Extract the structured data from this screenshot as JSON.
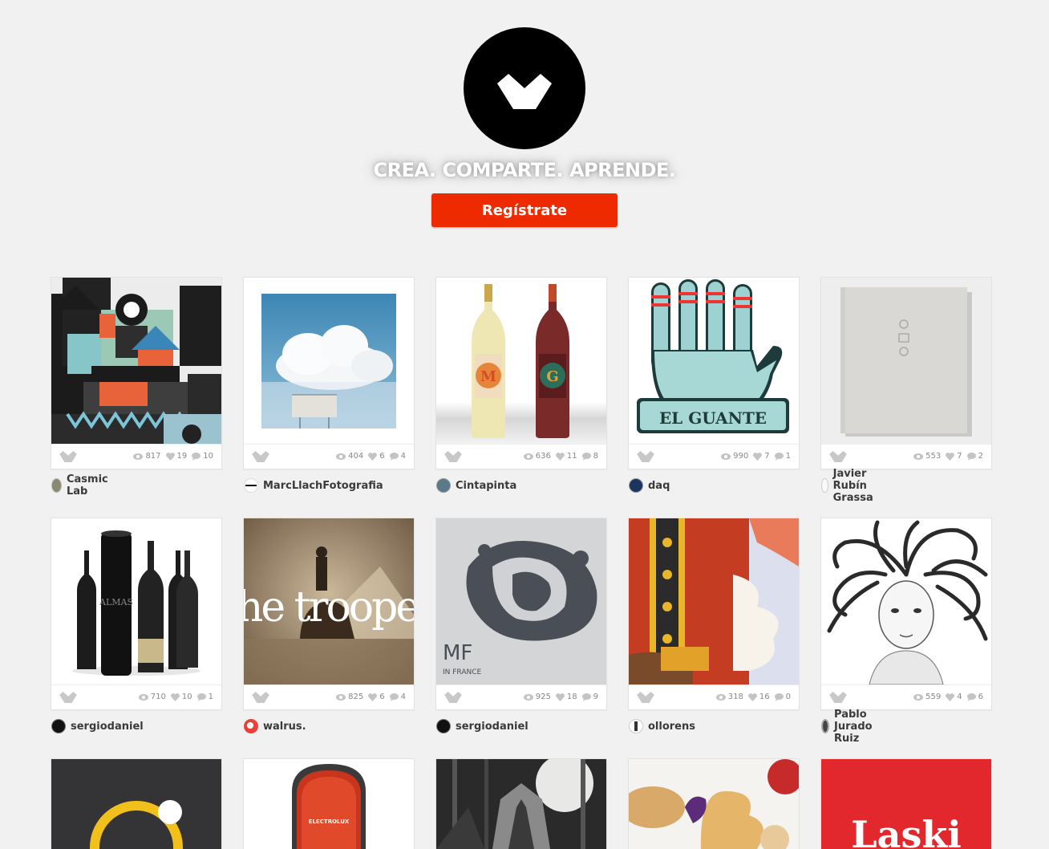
{
  "header": {
    "tagline": "CREA. COMPARTE. APRENDE.",
    "signup_label": "Regístrate",
    "brand_color": "#ee2b00"
  },
  "projects": [
    {
      "owner": "Casmic Lab",
      "views": "817",
      "likes": "19",
      "comments": "10"
    },
    {
      "owner": "MarcLlachFotografia",
      "views": "404",
      "likes": "6",
      "comments": "4"
    },
    {
      "owner": "Cintapinta",
      "views": "636",
      "likes": "11",
      "comments": "8"
    },
    {
      "owner": "daq",
      "views": "990",
      "likes": "7",
      "comments": "1"
    },
    {
      "owner": "Javier Rubín Grassa",
      "views": "553",
      "likes": "7",
      "comments": "2"
    },
    {
      "owner": "sergiodaniel",
      "views": "710",
      "likes": "10",
      "comments": "1"
    },
    {
      "owner": "walrus.",
      "views": "825",
      "likes": "6",
      "comments": "4"
    },
    {
      "owner": "sergiodaniel",
      "views": "925",
      "likes": "18",
      "comments": "9"
    },
    {
      "owner": "ollorens",
      "views": "318",
      "likes": "16",
      "comments": "0"
    },
    {
      "owner": "Pablo Jurado Ruiz",
      "views": "559",
      "likes": "4",
      "comments": "6"
    }
  ],
  "artwork_text": {
    "guante": "EL GUANTE",
    "trooper": "the trooper",
    "almas": "ALMAS",
    "mf": "MF",
    "mf_sub": "IN FRANCE",
    "bottle_m": "M",
    "bottle_g": "G",
    "electrolux": "ELECTROLUX",
    "laski": "Laski"
  },
  "icons": {
    "appreciate": "appreciate-icon",
    "views": "eye-icon",
    "likes": "heart-icon",
    "comments": "comment-icon"
  }
}
